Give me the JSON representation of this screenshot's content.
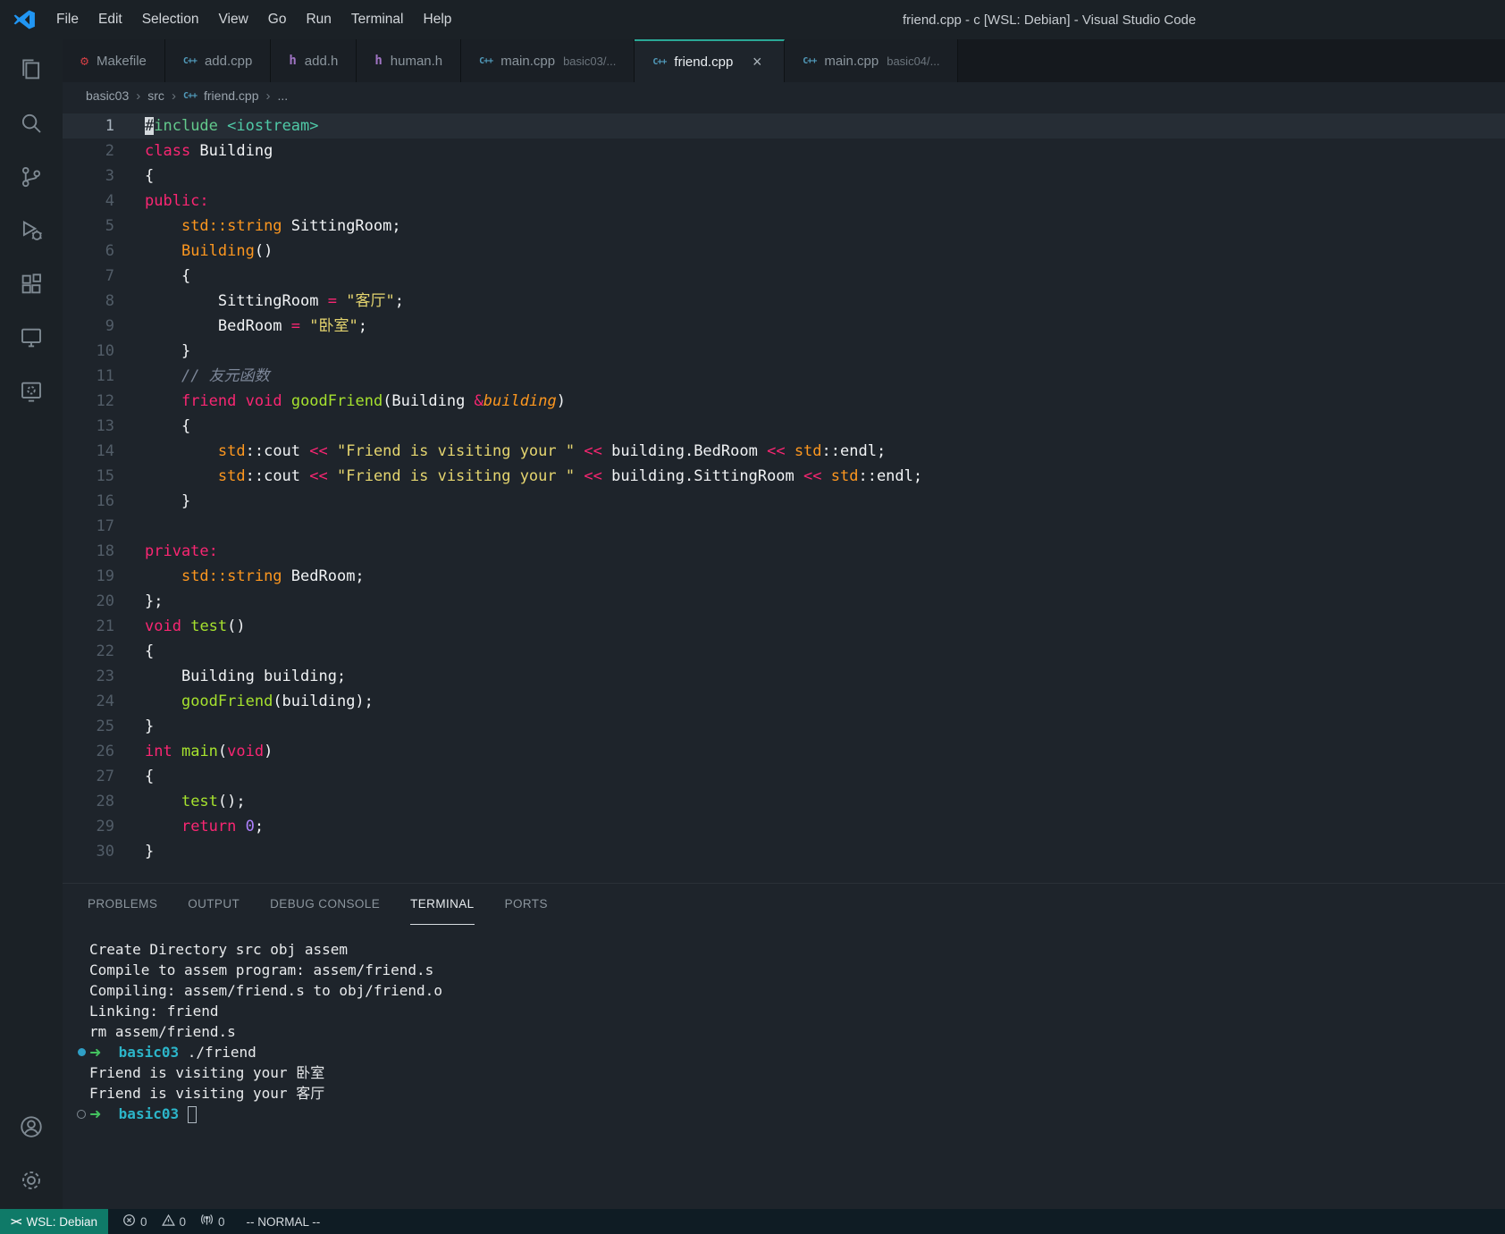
{
  "colors": {
    "brand_blue": "#2196f3",
    "remote_teal": "#0f7a68",
    "active_tab_accent": "#2aa896",
    "keyword": "#f92672",
    "function": "#a6e22e",
    "type": "#fd971f",
    "string": "#e5d56f",
    "number": "#ae81ff",
    "comment": "#7d8799",
    "terminal_arrow_green": "#43c25f",
    "terminal_dir_cyan": "#2cb5c9",
    "decoration_blue": "#2f9fc6"
  },
  "title_bar": {
    "menus": [
      "File",
      "Edit",
      "Selection",
      "View",
      "Go",
      "Run",
      "Terminal",
      "Help"
    ],
    "title": "friend.cpp - c [WSL: Debian] - Visual Studio Code"
  },
  "file_icons": {
    "makefile": {
      "glyph": "⚙",
      "color": "#cc3e44"
    },
    "cpp": {
      "glyph": "C++",
      "color": "#519aba"
    },
    "h": {
      "glyph": "h",
      "color": "#a074c4"
    }
  },
  "tabs": [
    {
      "label": "Makefile",
      "icon": "makefile",
      "active": false
    },
    {
      "label": "add.cpp",
      "icon": "cpp",
      "active": false
    },
    {
      "label": "add.h",
      "icon": "h",
      "active": false
    },
    {
      "label": "human.h",
      "icon": "h",
      "active": false
    },
    {
      "label": "main.cpp",
      "detail": "basic03/...",
      "icon": "cpp",
      "active": false
    },
    {
      "label": "friend.cpp",
      "icon": "cpp",
      "active": true
    },
    {
      "label": "main.cpp",
      "detail": "basic04/...",
      "icon": "cpp",
      "active": false
    }
  ],
  "breadcrumb": {
    "items": [
      {
        "label": "basic03"
      },
      {
        "label": "src"
      },
      {
        "label": "friend.cpp",
        "icon": "cpp"
      },
      {
        "label": "..."
      }
    ]
  },
  "editor": {
    "lines": [
      {
        "n": 1,
        "current": true,
        "tokens": [
          [
            "cur",
            "#"
          ],
          [
            "inc",
            "include"
          ],
          [
            "pl",
            " "
          ],
          [
            "hdr",
            "<iostream>"
          ]
        ]
      },
      {
        "n": 2,
        "tokens": [
          [
            "kw",
            "class"
          ],
          [
            "pl",
            " Building"
          ]
        ]
      },
      {
        "n": 3,
        "tokens": [
          [
            "pl",
            "{"
          ]
        ]
      },
      {
        "n": 4,
        "tokens": [
          [
            "kw",
            "public:"
          ]
        ]
      },
      {
        "n": 5,
        "tokens": [
          [
            "pl",
            "    "
          ],
          [
            "ty",
            "std::string"
          ],
          [
            "pl",
            " SittingRoom;"
          ]
        ]
      },
      {
        "n": 6,
        "tokens": [
          [
            "pl",
            "    "
          ],
          [
            "ty",
            "Building"
          ],
          [
            "pl",
            "()"
          ]
        ]
      },
      {
        "n": 7,
        "tokens": [
          [
            "pl",
            "    {"
          ]
        ]
      },
      {
        "n": 8,
        "tokens": [
          [
            "pl",
            "        SittingRoom "
          ],
          [
            "kw",
            "="
          ],
          [
            "pl",
            " "
          ],
          [
            "st",
            "\"客厅\""
          ],
          [
            "pl",
            ";"
          ]
        ]
      },
      {
        "n": 9,
        "tokens": [
          [
            "pl",
            "        BedRoom "
          ],
          [
            "kw",
            "="
          ],
          [
            "pl",
            " "
          ],
          [
            "st",
            "\"卧室\""
          ],
          [
            "pl",
            ";"
          ]
        ]
      },
      {
        "n": 10,
        "tokens": [
          [
            "pl",
            "    }"
          ]
        ]
      },
      {
        "n": 11,
        "tokens": [
          [
            "pl",
            "    "
          ],
          [
            "cm",
            "// 友元函数"
          ]
        ]
      },
      {
        "n": 12,
        "tokens": [
          [
            "pl",
            "    "
          ],
          [
            "kw",
            "friend"
          ],
          [
            "pl",
            " "
          ],
          [
            "kw",
            "void"
          ],
          [
            "pl",
            " "
          ],
          [
            "fn",
            "goodFriend"
          ],
          [
            "pl",
            "(Building "
          ],
          [
            "kw",
            "&"
          ],
          [
            "arg",
            "building"
          ],
          [
            "pl",
            ")"
          ]
        ]
      },
      {
        "n": 13,
        "tokens": [
          [
            "pl",
            "    {"
          ]
        ]
      },
      {
        "n": 14,
        "tokens": [
          [
            "pl",
            "        "
          ],
          [
            "ty",
            "std"
          ],
          [
            "pl",
            "::cout "
          ],
          [
            "kw",
            "<<"
          ],
          [
            "pl",
            " "
          ],
          [
            "st",
            "\"Friend is visiting your \""
          ],
          [
            "pl",
            " "
          ],
          [
            "kw",
            "<<"
          ],
          [
            "pl",
            " building.BedRoom "
          ],
          [
            "kw",
            "<<"
          ],
          [
            "pl",
            " "
          ],
          [
            "ty",
            "std"
          ],
          [
            "pl",
            "::endl;"
          ]
        ]
      },
      {
        "n": 15,
        "tokens": [
          [
            "pl",
            "        "
          ],
          [
            "ty",
            "std"
          ],
          [
            "pl",
            "::cout "
          ],
          [
            "kw",
            "<<"
          ],
          [
            "pl",
            " "
          ],
          [
            "st",
            "\"Friend is visiting your \""
          ],
          [
            "pl",
            " "
          ],
          [
            "kw",
            "<<"
          ],
          [
            "pl",
            " building.SittingRoom "
          ],
          [
            "kw",
            "<<"
          ],
          [
            "pl",
            " "
          ],
          [
            "ty",
            "std"
          ],
          [
            "pl",
            "::endl;"
          ]
        ]
      },
      {
        "n": 16,
        "tokens": [
          [
            "pl",
            "    }"
          ]
        ]
      },
      {
        "n": 17,
        "tokens": []
      },
      {
        "n": 18,
        "tokens": [
          [
            "kw",
            "private:"
          ]
        ]
      },
      {
        "n": 19,
        "tokens": [
          [
            "pl",
            "    "
          ],
          [
            "ty",
            "std::string"
          ],
          [
            "pl",
            " BedRoom;"
          ]
        ]
      },
      {
        "n": 20,
        "tokens": [
          [
            "pl",
            "};"
          ]
        ]
      },
      {
        "n": 21,
        "tokens": [
          [
            "kw",
            "void"
          ],
          [
            "pl",
            " "
          ],
          [
            "fn",
            "test"
          ],
          [
            "pl",
            "()"
          ]
        ]
      },
      {
        "n": 22,
        "tokens": [
          [
            "pl",
            "{"
          ]
        ]
      },
      {
        "n": 23,
        "tokens": [
          [
            "pl",
            "    Building building;"
          ]
        ]
      },
      {
        "n": 24,
        "tokens": [
          [
            "pl",
            "    "
          ],
          [
            "fn",
            "goodFriend"
          ],
          [
            "pl",
            "(building);"
          ]
        ]
      },
      {
        "n": 25,
        "tokens": [
          [
            "pl",
            "}"
          ]
        ]
      },
      {
        "n": 26,
        "tokens": [
          [
            "kw",
            "int"
          ],
          [
            "pl",
            " "
          ],
          [
            "fn",
            "main"
          ],
          [
            "pl",
            "("
          ],
          [
            "kw",
            "void"
          ],
          [
            "pl",
            ")"
          ]
        ]
      },
      {
        "n": 27,
        "tokens": [
          [
            "pl",
            "{"
          ]
        ]
      },
      {
        "n": 28,
        "tokens": [
          [
            "pl",
            "    "
          ],
          [
            "fn",
            "test"
          ],
          [
            "pl",
            "();"
          ]
        ]
      },
      {
        "n": 29,
        "tokens": [
          [
            "pl",
            "    "
          ],
          [
            "kw",
            "return"
          ],
          [
            "pl",
            " "
          ],
          [
            "nm",
            "0"
          ],
          [
            "pl",
            ";"
          ]
        ]
      },
      {
        "n": 30,
        "tokens": [
          [
            "pl",
            "}"
          ]
        ]
      }
    ]
  },
  "panel": {
    "tabs": [
      {
        "label": "PROBLEMS",
        "active": false
      },
      {
        "label": "OUTPUT",
        "active": false
      },
      {
        "label": "DEBUG CONSOLE",
        "active": false
      },
      {
        "label": "TERMINAL",
        "active": true
      },
      {
        "label": "PORTS",
        "active": false
      }
    ]
  },
  "terminal": {
    "lines": [
      {
        "deco": "none",
        "tokens": [
          [
            "pl",
            "Create Directory src obj assem"
          ]
        ]
      },
      {
        "deco": "none",
        "tokens": [
          [
            "pl",
            "Compile to assem program: assem/friend.s"
          ]
        ]
      },
      {
        "deco": "none",
        "tokens": [
          [
            "pl",
            "Compiling: assem/friend.s to obj/friend.o"
          ]
        ]
      },
      {
        "deco": "none",
        "tokens": [
          [
            "pl",
            "Linking: friend"
          ]
        ]
      },
      {
        "deco": "none",
        "tokens": [
          [
            "pl",
            "rm assem/friend.s"
          ]
        ]
      },
      {
        "deco": "filled",
        "tokens": [
          [
            "arrow",
            "➜"
          ],
          [
            "pl",
            "  "
          ],
          [
            "dir",
            "basic03"
          ],
          [
            "pl",
            " ./friend"
          ]
        ]
      },
      {
        "deco": "none",
        "tokens": [
          [
            "pl",
            "Friend is visiting your 卧室"
          ]
        ]
      },
      {
        "deco": "none",
        "tokens": [
          [
            "pl",
            "Friend is visiting your 客厅"
          ]
        ]
      },
      {
        "deco": "hollow",
        "tokens": [
          [
            "arrow",
            "➜"
          ],
          [
            "pl",
            "  "
          ],
          [
            "dir",
            "basic03"
          ],
          [
            "pl",
            " "
          ],
          [
            "cursor",
            ""
          ]
        ]
      }
    ]
  },
  "status_bar": {
    "remote": "WSL: Debian",
    "remote_glyph": "><",
    "errors": "0",
    "warnings": "0",
    "ports": "0",
    "mode": "-- NORMAL --"
  }
}
